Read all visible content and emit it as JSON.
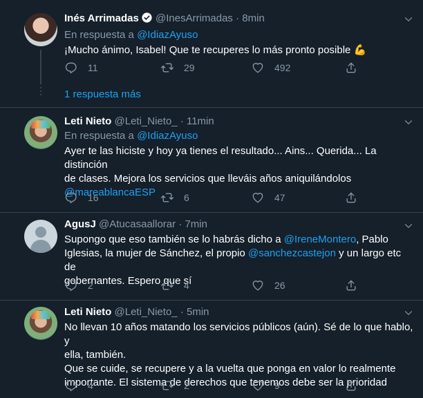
{
  "tweets": [
    {
      "name": "Inés Arrimadas",
      "handle": "@InesArrimadas",
      "time": "8min",
      "reply_prefix": "En respuesta a",
      "reply_to": "@IdiazAyuso",
      "text": "¡Mucho ánimo, Isabel! Que te recuperes lo más pronto posible",
      "emoji": "💪",
      "replies": "11",
      "retweets": "29",
      "likes": "492"
    },
    {
      "name": "Leti Nieto",
      "handle": "@Leti_Nieto_",
      "time": "11min",
      "reply_prefix": "En respuesta a",
      "reply_to": "@IdiazAyuso",
      "text_l1": "Ayer te las hiciste y hoy ya tienes el resultado... Ains... Querida... La distinción",
      "text_l2": "de clases. Mejora los servicios que lleváis años aniquilándolos",
      "mention": "@mareablancaESP",
      "replies": "16",
      "retweets": "6",
      "likes": "47"
    },
    {
      "name": "AgusJ",
      "handle": "@Atucasaallorar",
      "time": "7min",
      "text_a": "Supongo que eso también se lo habrás dicho a ",
      "mention1": "@IreneMontero",
      "text_b": ", Pablo",
      "text_c": "Iglesias, la mujer de Sánchez, el propio ",
      "mention2": "@sanchezcastejon",
      "text_d": " y un largo etc de",
      "text_e": "gobernantes. Espero que sí",
      "replies": "2",
      "retweets": "4",
      "likes": "26"
    },
    {
      "name": "Leti Nieto",
      "handle": "@Leti_Nieto_",
      "time": "5min",
      "text_l1": "No llevan 10 años matando los servicios públicos (aún). Sé de lo que hablo, y",
      "text_l2": "ella, también.",
      "text_l3": "Que se cuide, se recupere y a la vuelta que ponga en valor lo realmente",
      "text_l4": "importante. El sistema de derechos que tenemos debe ser la prioridad",
      "replies": "4",
      "retweets": "2",
      "likes": "9"
    }
  ],
  "more_replies": "1 respuesta más",
  "dot": "·"
}
